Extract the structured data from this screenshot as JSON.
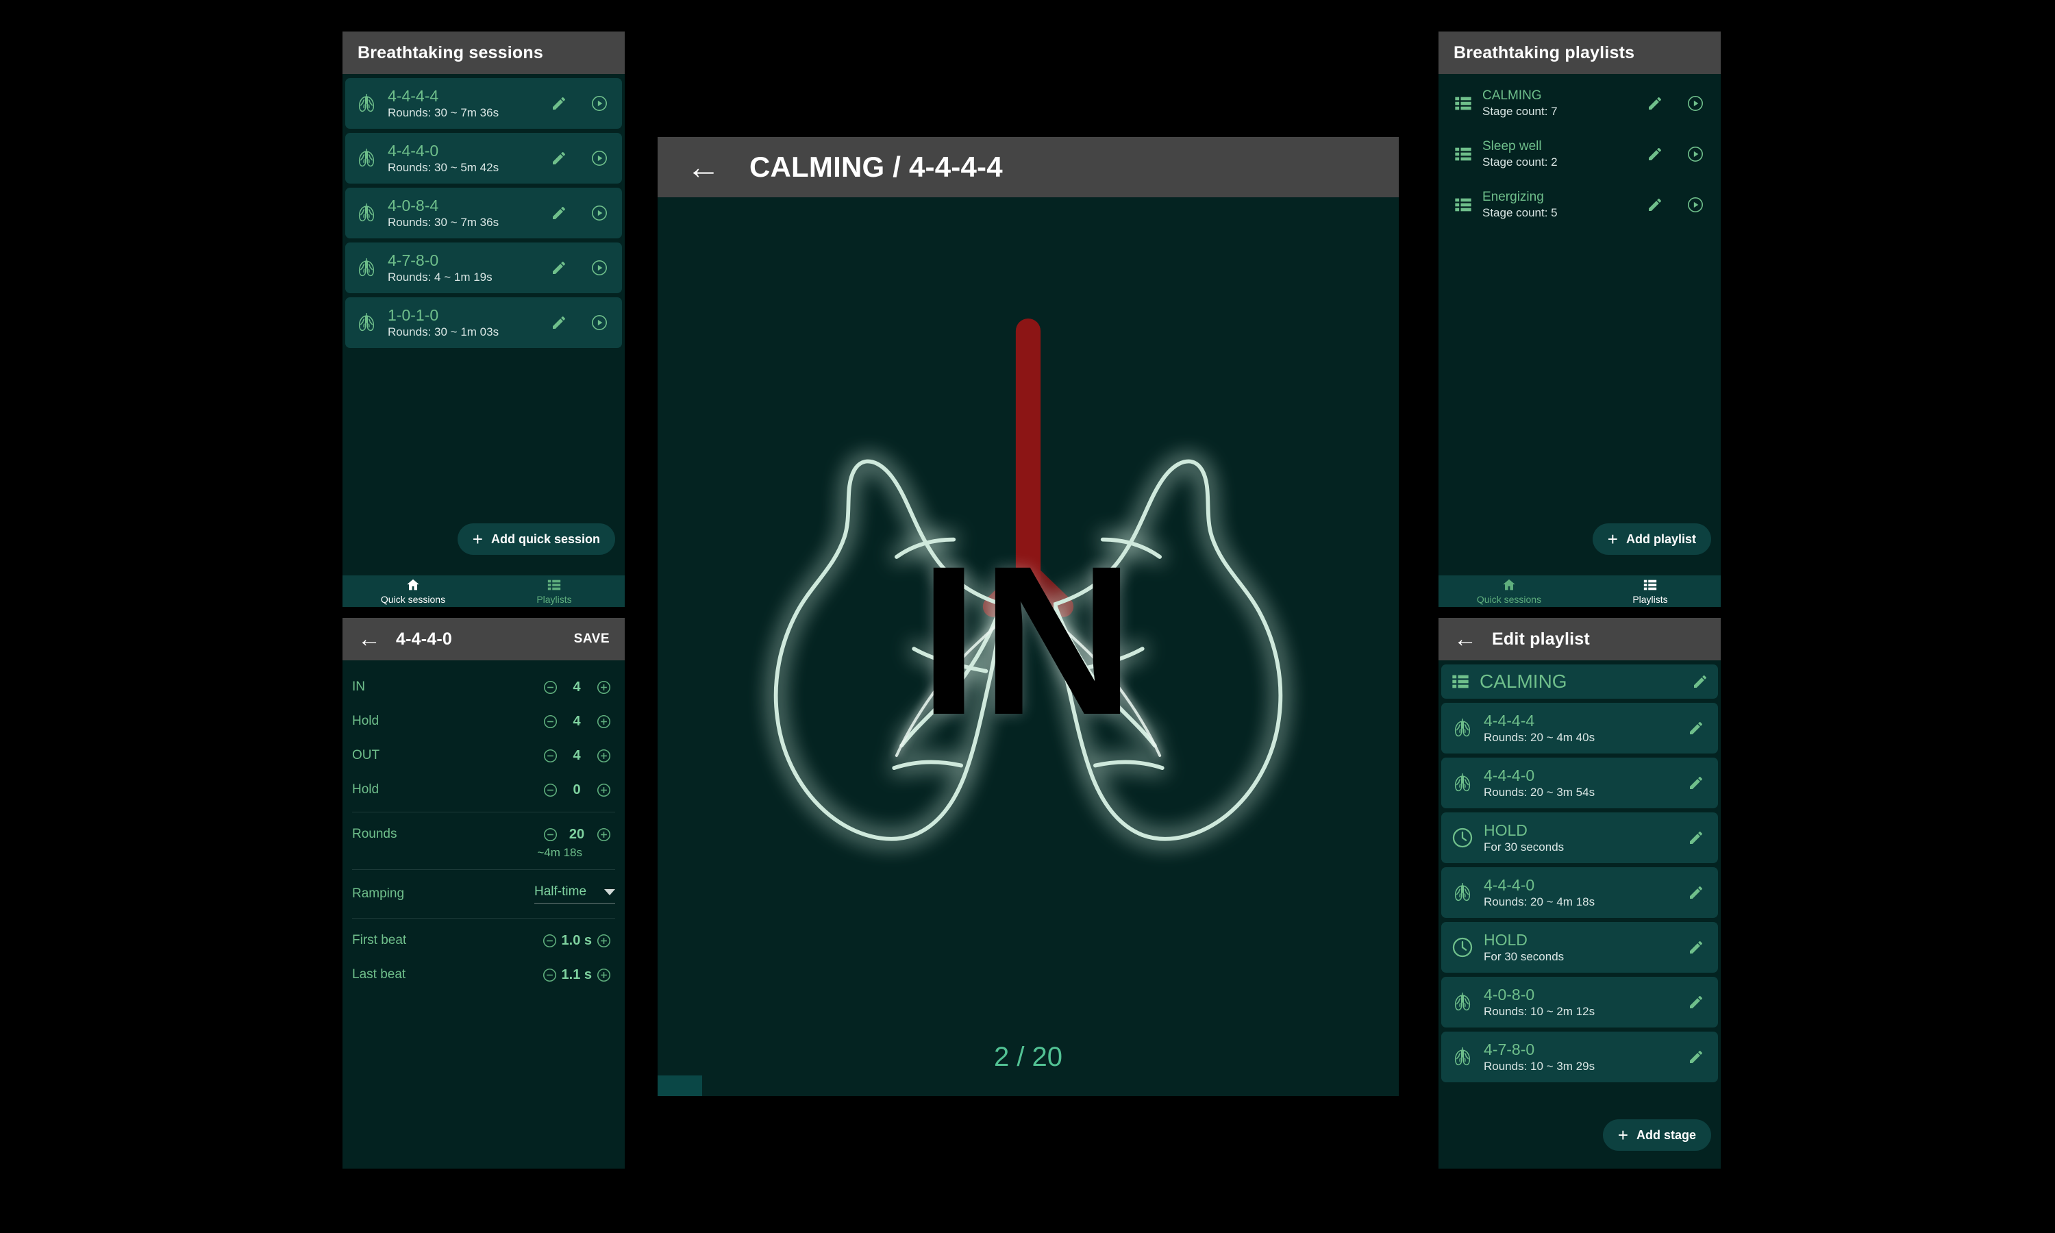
{
  "sessions_panel": {
    "title": "Breathtaking sessions",
    "items": [
      {
        "name": "4-4-4-4",
        "sub": "Rounds: 30 ~ 7m 36s",
        "icon": "lungs-icon"
      },
      {
        "name": "4-4-4-0",
        "sub": "Rounds: 30 ~ 5m 42s",
        "icon": "lungs-icon"
      },
      {
        "name": "4-0-8-4",
        "sub": "Rounds: 30 ~ 7m 36s",
        "icon": "lungs-icon"
      },
      {
        "name": "4-7-8-0",
        "sub": "Rounds: 4 ~ 1m 19s",
        "icon": "lungs-icon"
      },
      {
        "name": "1-0-1-0",
        "sub": "Rounds: 30 ~ 1m 03s",
        "icon": "lungs-icon"
      }
    ],
    "fab_label": "Add quick session",
    "nav": {
      "left_label": "Quick sessions",
      "right_label": "Playlists",
      "active": "left"
    }
  },
  "edit_session_panel": {
    "title": "4-4-4-0",
    "save_label": "SAVE",
    "rows": [
      {
        "label": "IN",
        "value": "4"
      },
      {
        "label": "Hold",
        "value": "4"
      },
      {
        "label": "OUT",
        "value": "4"
      },
      {
        "label": "Hold",
        "value": "0"
      }
    ],
    "rounds": {
      "label": "Rounds",
      "value": "20",
      "note": "~4m 18s"
    },
    "ramping": {
      "label": "Ramping",
      "value": "Half-time"
    },
    "first_beat": {
      "label": "First beat",
      "value": "1.0 s"
    },
    "last_beat": {
      "label": "Last beat",
      "value": "1.1 s"
    }
  },
  "playlists_panel": {
    "title": "Breathtaking playlists",
    "items": [
      {
        "name": "CALMING",
        "sub": "Stage count: 7",
        "icon": "list-icon"
      },
      {
        "name": "Sleep well",
        "sub": "Stage count: 2",
        "icon": "list-icon"
      },
      {
        "name": "Energizing",
        "sub": "Stage count: 5",
        "icon": "list-icon"
      }
    ],
    "fab_label": "Add playlist",
    "nav": {
      "left_label": "Quick sessions",
      "right_label": "Playlists",
      "active": "right"
    }
  },
  "edit_playlist_panel": {
    "title": "Edit playlist",
    "playlist_name": "CALMING",
    "stages": [
      {
        "name": "4-4-4-4",
        "sub": "Rounds: 20 ~ 4m 40s",
        "icon": "lungs-icon"
      },
      {
        "name": "4-4-4-0",
        "sub": "Rounds: 20 ~ 3m 54s",
        "icon": "lungs-icon"
      },
      {
        "name": "HOLD",
        "sub": "For 30 seconds",
        "icon": "clock-icon"
      },
      {
        "name": "4-4-4-0",
        "sub": "Rounds: 20 ~ 4m 18s",
        "icon": "lungs-icon"
      },
      {
        "name": "HOLD",
        "sub": "For 30 seconds",
        "icon": "clock-icon"
      },
      {
        "name": "4-0-8-0",
        "sub": "Rounds: 10 ~ 2m 12s",
        "icon": "lungs-icon"
      },
      {
        "name": "4-7-8-0",
        "sub": "Rounds: 10 ~ 3m 29s",
        "icon": "lungs-icon"
      }
    ],
    "fab_label": "Add stage"
  },
  "breathing_screen": {
    "title": "CALMING / 4-4-4-4",
    "phase": "IN",
    "counter": "2 / 20",
    "progress_percent": 6
  },
  "colors": {
    "app_background": "#000000",
    "panel_background": "#032220",
    "card_background": "#0d4140",
    "appbar_background": "#454545",
    "accent_green": "#6fbf8b",
    "bright_green": "#7fd3a0",
    "nav_background": "#0c3f3e",
    "trachea_red": "#8c1515",
    "breath_background": "#042321"
  }
}
